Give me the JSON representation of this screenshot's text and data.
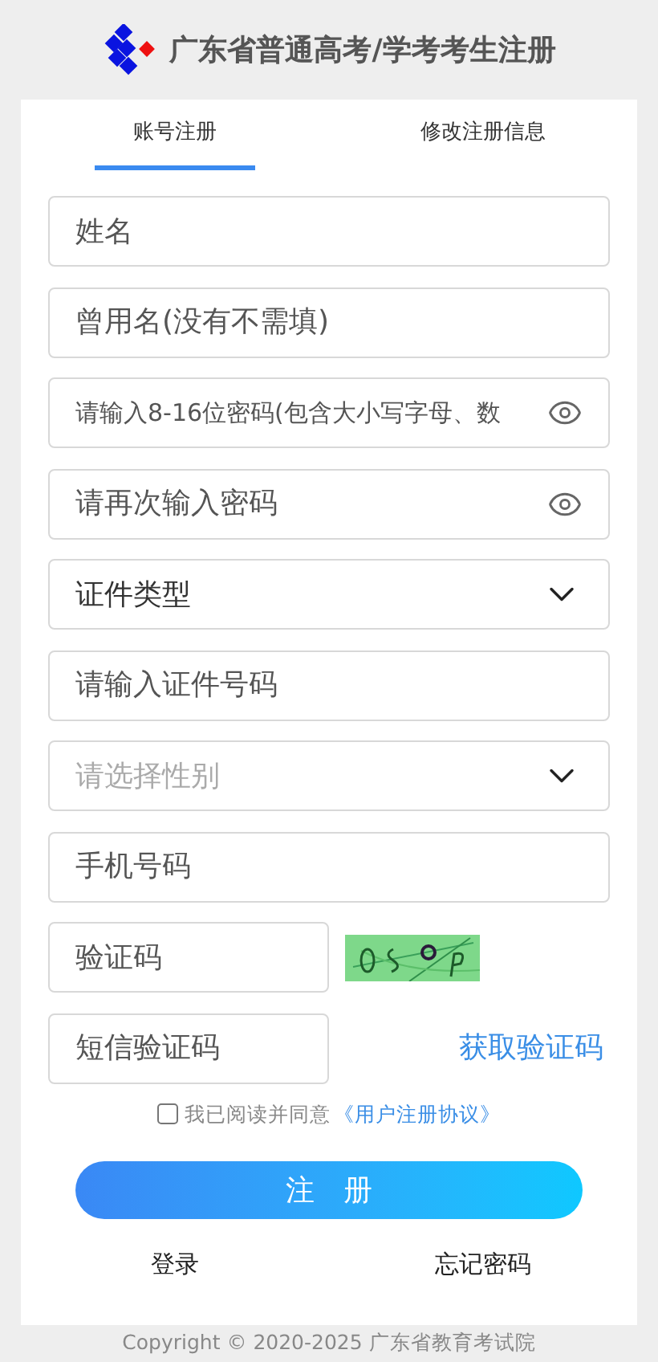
{
  "header": {
    "title": "广东省普通高考/学考考生注册"
  },
  "tabs": [
    {
      "label": "账号注册",
      "selected": true
    },
    {
      "label": "修改注册信息",
      "selected": false
    }
  ],
  "fields": [
    {
      "kind": "text",
      "placeholder": "姓名"
    },
    {
      "kind": "text",
      "placeholder": "曾用名(没有不需填)"
    },
    {
      "kind": "password",
      "placeholder": "请输入8-16位密码(包含大小写字母、数"
    },
    {
      "kind": "password",
      "placeholder": "请再次输入密码"
    },
    {
      "kind": "select",
      "value": "证件类型"
    },
    {
      "kind": "text",
      "placeholder": "请输入证件号码"
    },
    {
      "kind": "select",
      "placeholder": "请选择性别"
    },
    {
      "kind": "text",
      "placeholder": "手机号码"
    },
    {
      "kind": "captcha",
      "placeholder": "验证码"
    },
    {
      "kind": "sms",
      "placeholder": "短信验证码",
      "action": "获取验证码"
    }
  ],
  "agreement": {
    "checked": false,
    "text": "我已阅读并同意",
    "link": "《用户注册协议》"
  },
  "submit": "注　册",
  "links": [
    "登录",
    "忘记密码"
  ],
  "footer": "Copyright © 2020-2025 广东省教育考试院"
}
